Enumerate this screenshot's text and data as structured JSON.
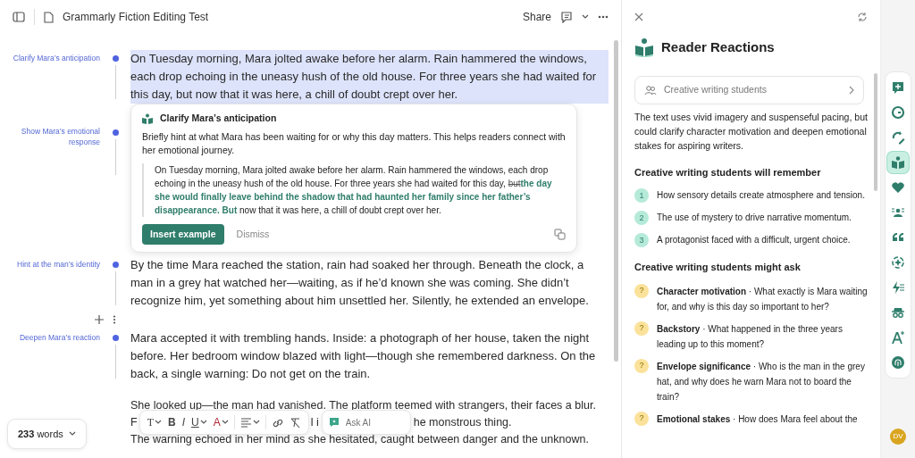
{
  "topbar": {
    "title": "Grammarly Fiction Editing Test",
    "share": "Share"
  },
  "document": {
    "blocks": [
      {
        "kind": "paragraph",
        "note": "Clarify Mara’s anticipation",
        "highlighted": true,
        "text": "On Tuesday morning, Mara jolted awake before her alarm. Rain hammered the windows, each drop echoing in the uneasy hush of the old house. For three years she had waited for this day, but now that it was here, a chill of doubt crept over her."
      },
      {
        "kind": "suggestion",
        "note": "Show Mara’s emotional response",
        "title": "Clarify Mara’s anticipation",
        "body": "Briefly hint at what Mara has been waiting for or why this day matters. This helps readers connect with her emotional journey.",
        "example": {
          "before": "On Tuesday morning, Mara jolted awake before her alarm. Rain hammered the windows, each drop echoing in the uneasy hush of the old house. For three years she had waited for this day, ",
          "deleted": "but",
          "inserted": "the day she would finally leave behind the shadow that had haunted her family since her father’s disappearance. But",
          "after": " now that it was here, a chill of doubt crept over her."
        },
        "primary": "Insert example",
        "secondary": "Dismiss"
      },
      {
        "kind": "paragraph",
        "note": "Hint at the man’s identity",
        "highlighted": false,
        "text": "By the time Mara reached the station, rain had soaked her through. Beneath the clock, a man in a grey hat watched her—waiting, as if he’d known she was coming. She didn’t recognize him, yet something about him unsettled her. Silently, he extended an envelope."
      },
      {
        "kind": "tools"
      },
      {
        "kind": "paragraph",
        "note": "Deepen Mara’s reaction",
        "highlighted": false,
        "text": "Mara accepted it with trembling hands. Inside: a photograph of her house, taken the night before. Her bedroom window blazed with light—though she remembered darkness. On the back, a single warning: Do not get on the train."
      },
      {
        "kind": "covered",
        "first": "She looked up—the man had vanished. The platform teemed with strangers, their faces a blur.",
        "fragments": [
          "F",
          "l i",
          "he monstrous thing."
        ],
        "last": "The warning echoed in her mind as she hesitated, caught between danger and the unknown."
      }
    ]
  },
  "word_count": "**233** words",
  "format_toolbar": {
    "items": [
      {
        "kind": "type",
        "label": "T",
        "caret": true
      },
      {
        "kind": "bold",
        "label": "B",
        "caret": false
      },
      {
        "kind": "italic",
        "label": "I",
        "caret": false
      },
      {
        "kind": "underline",
        "label": "U",
        "caret": true
      },
      {
        "kind": "color",
        "label": "A",
        "caret": true
      },
      {
        "kind": "align",
        "caret": true
      },
      {
        "kind": "link",
        "caret": false
      },
      {
        "kind": "clear",
        "caret": false
      }
    ],
    "ask_placeholder": "Ask AI"
  },
  "panel": {
    "title": "Reader Reactions",
    "audience": "Creative writing students",
    "summary": "The text uses vivid imagery and suspenseful pacing, but could clarify character motivation and deepen emotional stakes for aspiring writers.",
    "remember_heading": "Creative writing students will remember",
    "remember": [
      {
        "number": "1",
        "text": "How sensory details create atmosphere and tension."
      },
      {
        "number": "2",
        "text": "The use of mystery to drive narrative momentum."
      },
      {
        "number": "3",
        "text": "A protagonist faced with a difficult, urgent choice."
      }
    ],
    "ask_heading": "Creative writing students might ask",
    "questions": [
      {
        "mark": "?",
        "text": "**Character motivation** · What exactly is Mara waiting for, and why is this day so important to her?"
      },
      {
        "mark": "?",
        "text": "**Backstory** · What happened in the three years leading up to this moment?"
      },
      {
        "mark": "?",
        "text": "**Envelope significance** · Who is the man in the grey hat, and why does he warn Mara not to board the train?"
      },
      {
        "mark": "?",
        "text": "**Emotional stakes** · How does Mara feel about the"
      }
    ]
  },
  "rail": {
    "items": [
      {
        "selected": false
      },
      {
        "selected": false
      },
      {
        "selected": false
      },
      {
        "selected": true
      },
      {
        "selected": false
      },
      {
        "selected": false
      },
      {
        "selected": false
      },
      {
        "selected": false
      },
      {
        "selected": false
      },
      {
        "selected": false
      },
      {
        "selected": false
      },
      {
        "selected": false
      }
    ],
    "avatar": "DV"
  }
}
